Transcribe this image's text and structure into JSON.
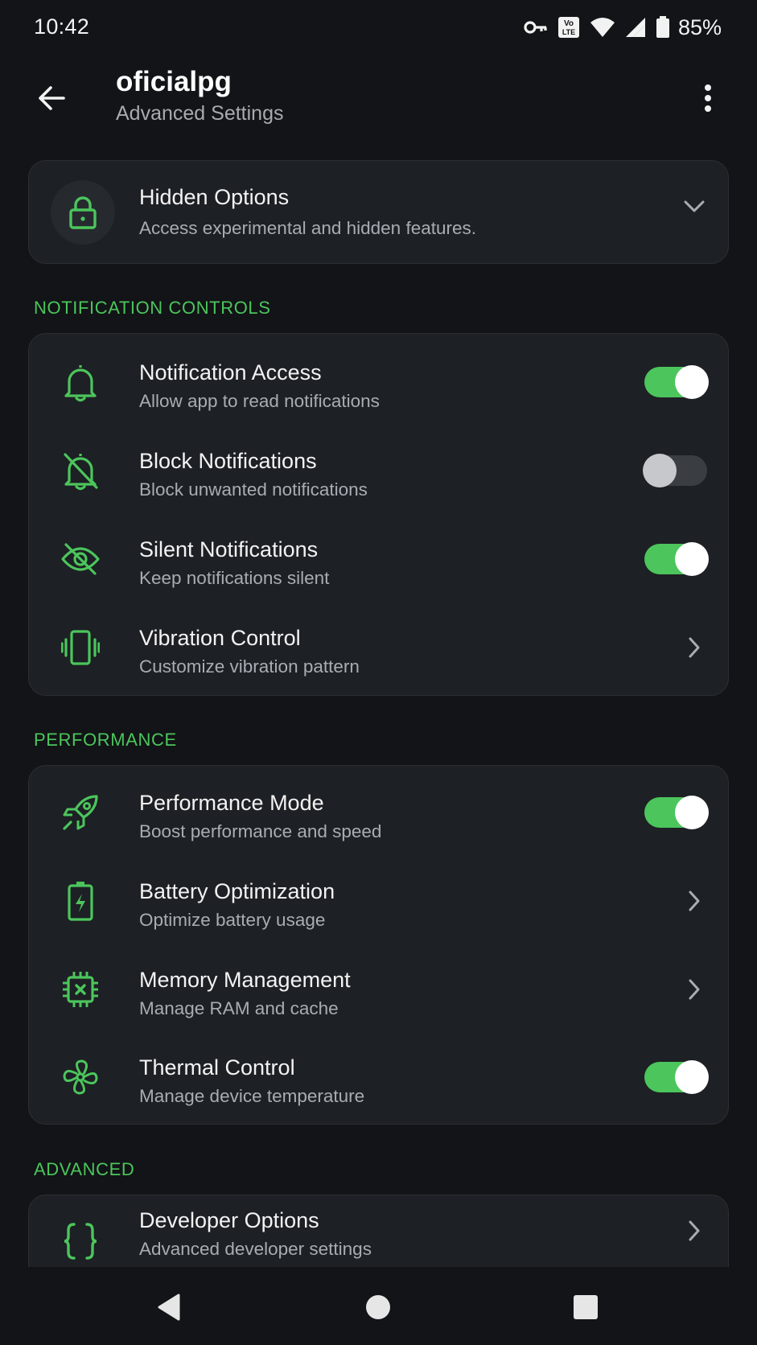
{
  "status_bar": {
    "time": "10:42",
    "battery": "85%",
    "icons": [
      "vpn-key-icon",
      "volte-icon",
      "wifi-icon",
      "signal-icon",
      "battery-icon"
    ]
  },
  "header": {
    "title": "oficialpg",
    "subtitle": "Advanced Settings",
    "back_icon": "arrow-back-icon",
    "menu_icon": "more-vert-icon"
  },
  "hidden_options": {
    "title": "Hidden Options",
    "description": "Access experimental and hidden features.",
    "icon": "lock-icon",
    "expanded": false
  },
  "sections": {
    "notification": {
      "header": "NOTIFICATION CONTROLS",
      "items": [
        {
          "title": "Notification Access",
          "subtitle": "Allow app to read notifications",
          "icon": "bell-icon",
          "control": "toggle",
          "on": true
        },
        {
          "title": "Block Notifications",
          "subtitle": "Block unwanted notifications",
          "icon": "bell-off-icon",
          "control": "toggle",
          "on": false
        },
        {
          "title": "Silent Notifications",
          "subtitle": "Keep notifications silent",
          "icon": "eye-off-icon",
          "control": "toggle",
          "on": true
        },
        {
          "title": "Vibration Control",
          "subtitle": "Customize vibration pattern",
          "icon": "vibration-icon",
          "control": "chevron"
        }
      ]
    },
    "performance": {
      "header": "PERFORMANCE",
      "items": [
        {
          "title": "Performance Mode",
          "subtitle": "Boost performance and speed",
          "icon": "rocket-icon",
          "control": "toggle",
          "on": true
        },
        {
          "title": "Battery Optimization",
          "subtitle": "Optimize battery usage",
          "icon": "battery-charging-icon",
          "control": "chevron"
        },
        {
          "title": "Memory Management",
          "subtitle": "Manage RAM and cache",
          "icon": "memory-chip-icon",
          "control": "chevron"
        },
        {
          "title": "Thermal Control",
          "subtitle": "Manage device temperature",
          "icon": "fan-icon",
          "control": "toggle",
          "on": true
        }
      ]
    },
    "advanced": {
      "header": "ADVANCED",
      "items": [
        {
          "title": "Developer Options",
          "subtitle": "Advanced developer settings",
          "icon": "code-braces-icon",
          "control": "chevron"
        }
      ]
    }
  },
  "nav_bar": {
    "buttons": [
      "nav-back-icon",
      "nav-home-icon",
      "nav-recents-icon"
    ]
  },
  "colors": {
    "accent": "#4cc55c",
    "background": "#121417",
    "card": "#1d2024",
    "secondary_text": "#a9adb3"
  }
}
